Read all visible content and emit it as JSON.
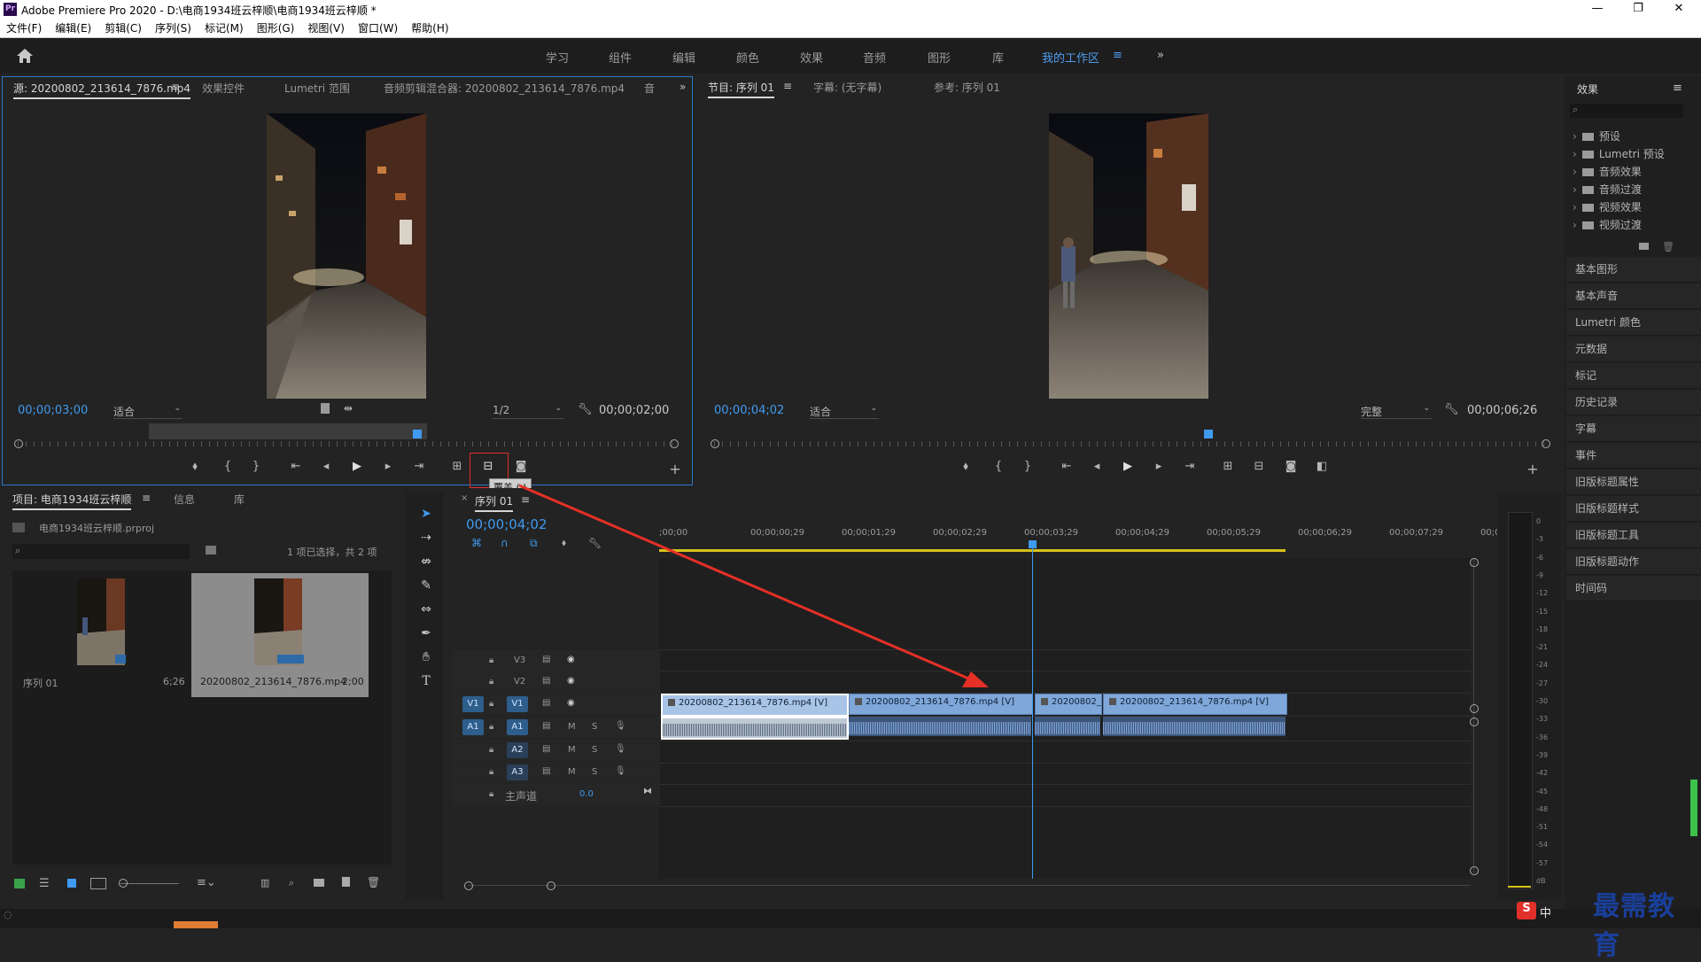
{
  "window": {
    "title": "Adobe Premiere Pro 2020 - D:\\电商1934班云梓顺\\电商1934班云梓顺 *",
    "logo": "Pr",
    "minimize_icon": "minimize-icon",
    "controls": [
      "—",
      "❐",
      "✕"
    ]
  },
  "menu": [
    "文件(F)",
    "编辑(E)",
    "剪辑(C)",
    "序列(S)",
    "标记(M)",
    "图形(G)",
    "视图(V)",
    "窗口(W)",
    "帮助(H)"
  ],
  "workspaces": {
    "tabs": [
      "学习",
      "组件",
      "编辑",
      "颜色",
      "效果",
      "音频",
      "图形",
      "库",
      "我的工作区"
    ],
    "active": "我的工作区",
    "menu_icon": "≡",
    "more_icon": "»"
  },
  "source_panel": {
    "tabs": [
      "源: 20200802_213614_7876.mp4",
      "效果控件",
      "Lumetri 范围",
      "音频剪辑混合器: 20200802_213614_7876.mp4",
      "音"
    ],
    "menu_icon": "≡",
    "expand_icon": "»",
    "timecode_in": "00;00;03;00",
    "fit": "适合",
    "resolution": "1/2",
    "timecode_out": "00;00;02;00",
    "playhead_fraction": 0.61,
    "tooltip": "覆盖 (.)"
  },
  "program_panel": {
    "tabs": [
      "节目: 序列 01",
      "字幕: (无字幕)",
      "参考: 序列 01"
    ],
    "menu_icon": "≡",
    "timecode_in": "00;00;04;02",
    "fit": "适合",
    "resolution": "完整",
    "timecode_out": "00;00;06;26",
    "playhead_fraction": 0.595
  },
  "project_panel": {
    "tabs": [
      "项目: 电商1934班云梓顺",
      "信息",
      "库"
    ],
    "menu_icon": "≡",
    "project_file": "电商1934班云梓顺.prproj",
    "selection_info": "1 项已选择，共 2 项",
    "items": [
      {
        "name": "序列 01",
        "duration": "6;26",
        "selected": false
      },
      {
        "name": "20200802_213614_7876.mp4",
        "duration": "2;00",
        "selected": true
      }
    ]
  },
  "timeline": {
    "tab": "序列 01",
    "menu_icon": "≡",
    "timecode": "00;00;04;02",
    "ruler": [
      ";00;00",
      "00;00;00;29",
      "00;00;01;29",
      "00;00;02;29",
      "00;00;03;29",
      "00;00;04;29",
      "00;00;05;29",
      "00;00;06;29",
      "00;00;07;29",
      "00;0"
    ],
    "video_tracks": [
      "V3",
      "V2",
      "V1"
    ],
    "audio_tracks": [
      "A1",
      "A2",
      "A3"
    ],
    "source_video": "V1",
    "source_audio": "A1",
    "master_label": "主声道",
    "master_value": "0.0",
    "clips": [
      {
        "label": "20200802_213614_7876.mp4 [V]",
        "selected": true
      },
      {
        "label": "20200802_213614_7876.mp4 [V]",
        "selected": false
      },
      {
        "label": "20200802_",
        "selected": false
      },
      {
        "label": "20200802_213614_7876.mp4 [V]",
        "selected": false
      }
    ],
    "track_buttons": {
      "m": "M",
      "s": "S"
    }
  },
  "effects_panel": {
    "title": "效果",
    "menu_icon": "≡",
    "tree": [
      "预设",
      "Lumetri 预设",
      "音频效果",
      "音频过渡",
      "视频效果",
      "视频过渡"
    ],
    "panels": [
      "基本图形",
      "基本声音",
      "Lumetri 颜色",
      "元数据",
      "标记",
      "历史记录",
      "字幕",
      "事件",
      "旧版标题属性",
      "旧版标题样式",
      "旧版标题工具",
      "旧版标题动作",
      "时间码"
    ]
  },
  "meter": {
    "labels": [
      "0",
      "-3",
      "-6",
      "-9",
      "-12",
      "-15",
      "-18",
      "-21",
      "-24",
      "-27",
      "-30",
      "-33",
      "-36",
      "-39",
      "-42",
      "-45",
      "-48",
      "-51",
      "-54",
      "-57",
      "dB"
    ]
  },
  "watermark": "最需教育",
  "ime": "中",
  "colors": {
    "accent": "#3f9af0",
    "highlight_box": "#e0302a",
    "arrow": "#e53025",
    "clip_video": "#7fa7d9",
    "clip_audio": "#3c557a"
  }
}
